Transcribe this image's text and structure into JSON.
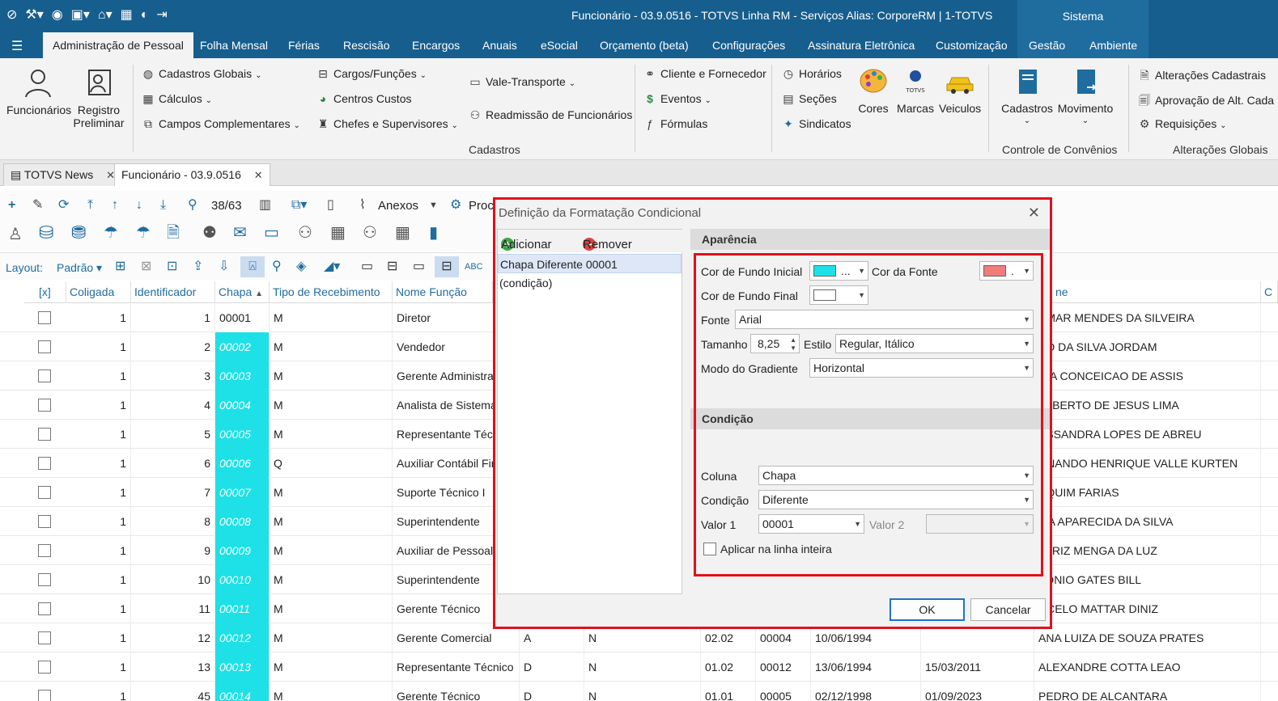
{
  "titlebar": {
    "title": "Funcionário - 03.9.0516 - TOTVS Linha RM - Serviços  Alias: CorporeRM | 1-TOTVS",
    "sistema": "Sistema"
  },
  "menu": {
    "tabs": [
      "Administração de Pessoal",
      "Folha Mensal",
      "Férias",
      "Rescisão",
      "Encargos",
      "Anuais",
      "eSocial",
      "Orçamento (beta)",
      "Configurações",
      "Assinatura Eletrônica",
      "Customização",
      "Gestão",
      "Ambiente"
    ]
  },
  "ribbon": {
    "funcionarios": "Funcionários",
    "registro_1": "Registro",
    "registro_2": "Preliminar",
    "cadastros_globais": "Cadastros Globais",
    "calculos": "Cálculos",
    "campos_complementares": "Campos Complementares",
    "cargos": "Cargos/Funções",
    "centros_custos": "Centros Custos",
    "chefes": "Chefes e Supervisores",
    "vale_transporte": "Vale-Transporte",
    "readmissao": "Readmissão de Funcionários",
    "cliente_fornecedor": "Cliente e Fornecedor",
    "eventos": "Eventos",
    "formulas": "Fórmulas",
    "horarios": "Horários",
    "secoes": "Seções",
    "sindicatos": "Sindicatos",
    "cores": "Cores",
    "marcas": "Marcas",
    "veiculos": "Veiculos",
    "cadastros_btn": "Cadastros",
    "movimento": "Movimento",
    "alteracoes_cadastrais": "Alterações Cadastrais",
    "aprovacao": "Aprovação de Alt. Cada",
    "requisicoes": "Requisições",
    "group_cadastros": "Cadastros",
    "group_convenios": "Controle de Convênios",
    "group_alteracoes": "Alterações Globais",
    "totvs_logo": "TOTVS"
  },
  "doctabs": [
    "TOTVS News",
    "Funcionário - 03.9.0516"
  ],
  "toolbar": {
    "record_pos": "38/63",
    "anexos": "Anexos",
    "proc": "Proc",
    "layout_label": "Layout:",
    "layout_value": "Padrão"
  },
  "grid": {
    "headers": [
      "[x]",
      "Coligada",
      "Identificador",
      "Chapa",
      "Tipo de Recebimento",
      "Nome Função",
      "ne",
      "C"
    ],
    "rows": [
      {
        "col": "1",
        "id": "1",
        "chapa": "00001",
        "tipo": "M",
        "funcao": "Diretor",
        "nome": "AMAR MENDES DA SILVEIRA"
      },
      {
        "col": "1",
        "id": "2",
        "chapa": "00002",
        "tipo": "M",
        "funcao": "Vendedor",
        "nome": "AO DA SILVA JORDAM"
      },
      {
        "col": "1",
        "id": "3",
        "chapa": "00003",
        "tipo": "M",
        "funcao": "Gerente Administra",
        "nome": "RIA CONCEICAO DE ASSIS"
      },
      {
        "col": "1",
        "id": "4",
        "chapa": "00004",
        "tipo": "M",
        "funcao": "Analista de Sistema",
        "nome": "ALBERTO DE JESUS LIMA"
      },
      {
        "col": "1",
        "id": "5",
        "chapa": "00005",
        "tipo": "M",
        "funcao": "Representante Téc",
        "nome": "ESSANDRA LOPES DE ABREU"
      },
      {
        "col": "1",
        "id": "6",
        "chapa": "00006",
        "tipo": "Q",
        "funcao": "Auxiliar Contábil Fir",
        "nome": "RNANDO HENRIQUE VALLE KURTEN"
      },
      {
        "col": "1",
        "id": "7",
        "chapa": "00007",
        "tipo": "M",
        "funcao": "Suporte Técnico I",
        "nome": "AQUIM FARIAS"
      },
      {
        "col": "1",
        "id": "8",
        "chapa": "00008",
        "tipo": "M",
        "funcao": "Superintendente",
        "nome": "LIA APARECIDA DA SILVA"
      },
      {
        "col": "1",
        "id": "9",
        "chapa": "00009",
        "tipo": "M",
        "funcao": "Auxiliar de Pessoal",
        "nome": "ATRIZ MENGA DA LUZ"
      },
      {
        "col": "1",
        "id": "10",
        "chapa": "00010",
        "tipo": "M",
        "funcao": "Superintendente",
        "nome": "TONIO GATES BILL"
      },
      {
        "col": "1",
        "id": "11",
        "chapa": "00011",
        "tipo": "M",
        "funcao": "Gerente Técnico",
        "nome": "RCELO MATTAR DINIZ"
      },
      {
        "col": "1",
        "id": "12",
        "chapa": "00012",
        "tipo": "M",
        "funcao": "Gerente Comercial",
        "c1": "A",
        "c2": "N",
        "c3": "02.02",
        "c4": "00004",
        "c5": "10/06/1994",
        "c6": "",
        "nome": "ANA LUIZA  DE SOUZA PRATES"
      },
      {
        "col": "1",
        "id": "13",
        "chapa": "00013",
        "tipo": "M",
        "funcao": "Representante Técnico",
        "c1": "D",
        "c2": "N",
        "c3": "01.02",
        "c4": "00012",
        "c5": "13/06/1994",
        "c6": "15/03/2011",
        "nome": "ALEXANDRE COTTA LEAO"
      },
      {
        "col": "1",
        "id": "45",
        "chapa": "00014",
        "tipo": "M",
        "funcao": "Gerente Técnico",
        "c1": "D",
        "c2": "N",
        "c3": "01.01",
        "c4": "00005",
        "c5": "02/12/1998",
        "c6": "01/09/2023",
        "nome": "PEDRO DE ALCANTARA"
      }
    ]
  },
  "dialog": {
    "title": "Definição da Formatação Condicional",
    "add": "Adicionar",
    "remove": "Remover",
    "list": [
      "Chapa Diferente 00001",
      "(condição)"
    ],
    "aparencia": "Aparência",
    "cor_fundo_inicial": "Cor de Fundo Inicial",
    "cor_fonte": "Cor da Fonte",
    "cor_fundo_final": "Cor de Fundo Final",
    "fonte_label": "Fonte",
    "fonte_value": "Arial",
    "tamanho_label": "Tamanho",
    "tamanho_value": "8,25",
    "estilo_label": "Estilo",
    "estilo_value": "Regular, Itálico",
    "modo_label": "Modo do Gradiente",
    "modo_value": "Horizontal",
    "condicao_section": "Condição",
    "coluna_label": "Coluna",
    "coluna_value": "Chapa",
    "condicao_label": "Condição",
    "condicao_value": "Diferente",
    "valor1_label": "Valor 1",
    "valor1_value": "00001",
    "valor2_label": "Valor 2",
    "valor2_value": "",
    "aplicar": "Aplicar na linha inteira",
    "ok": "OK",
    "cancel": "Cancelar",
    "swatch_inicial_suffix": "...",
    "swatch_fonte_suffix": ".",
    "colors": {
      "inicial": "#1de1e6",
      "fonte": "#f07c7c",
      "final": "#ffffff",
      "highlight": "#e0111b"
    }
  }
}
